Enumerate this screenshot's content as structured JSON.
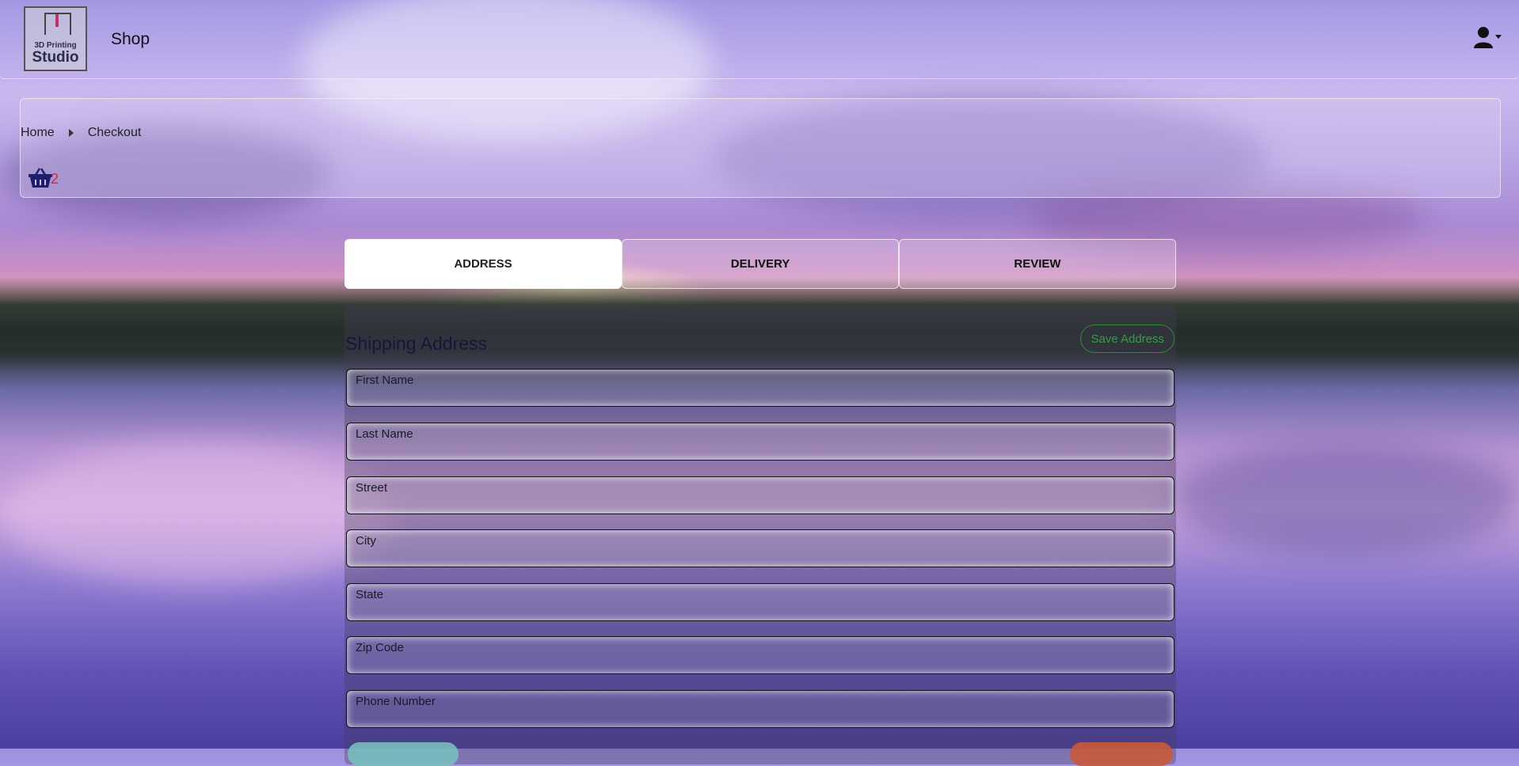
{
  "navbar": {
    "logo_line1": "3D Printing",
    "logo_line2": "Studio",
    "brand": "Shop",
    "user_icon": "user-icon",
    "caret_icon": "caret-down-icon"
  },
  "breadcrumb": {
    "items": [
      "Home",
      "Checkout"
    ],
    "separator_icon": "chevron-right-icon"
  },
  "cart": {
    "icon": "basket-icon",
    "count": "2",
    "count_color": "#e0203a"
  },
  "tabs": [
    "ADDRESS",
    "DELIVERY",
    "REVIEW"
  ],
  "active_tab": "ADDRESS",
  "form": {
    "title": "Shipping Address",
    "save_label": "Save Address",
    "fields": {
      "first_name": {
        "label": "First Name",
        "value": ""
      },
      "last_name": {
        "label": "Last Name",
        "value": ""
      },
      "street": {
        "label": "Street",
        "value": ""
      },
      "city": {
        "label": "City",
        "value": ""
      },
      "state": {
        "label": "State",
        "value": ""
      },
      "zip": {
        "label": "Zip Code",
        "value": ""
      },
      "phone": {
        "label": "Phone Number",
        "value": ""
      }
    }
  },
  "colors": {
    "save_accent": "#2f9e44",
    "active_tab_bg": "#ffffff"
  }
}
